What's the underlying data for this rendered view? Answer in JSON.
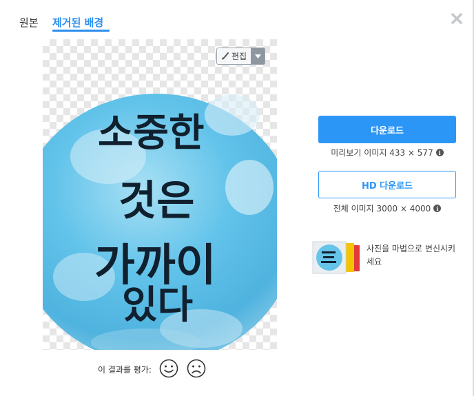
{
  "tabs": {
    "original": "원본",
    "removed_bg": "제거된 배경"
  },
  "preview": {
    "edit_label": "편집",
    "stone_text": [
      "소중한",
      "것은",
      "가까이",
      "있다"
    ]
  },
  "rating": {
    "label": "이 결과를 평가:"
  },
  "download": {
    "label": "다운로드",
    "preview_info": "미리보기 이미지 433 × 577"
  },
  "hd_download": {
    "label": "HD 다운로드",
    "full_info": "전체 이미지 3000 × 4000"
  },
  "promo": {
    "text": "사진을 마법으로 변신시키세요"
  },
  "colors": {
    "accent": "#2c96f7",
    "tab_active": "#2c8ff0"
  },
  "icons": [
    "close-icon",
    "brush-icon",
    "caret-down-icon",
    "info-icon",
    "smile-icon",
    "frown-icon"
  ]
}
